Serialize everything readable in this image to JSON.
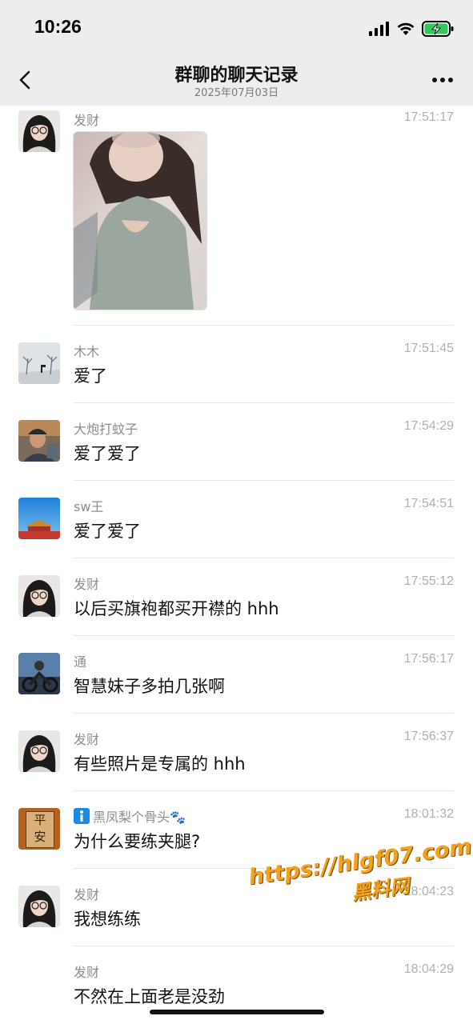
{
  "status_bar": {
    "time": "10:26"
  },
  "header": {
    "title": "群聊的聊天记录",
    "subtitle": "2025年07月03日"
  },
  "messages": [
    {
      "sender": "发财",
      "time": "17:51:17",
      "type": "image"
    },
    {
      "sender": "木木",
      "time": "17:51:45",
      "text": "爱了"
    },
    {
      "sender": "大炮打蚊子",
      "time": "17:54:29",
      "text": "爱了爱了"
    },
    {
      "sender": "sw王",
      "time": "17:54:51",
      "text": "爱了爱了"
    },
    {
      "sender": "发财",
      "time": "17:55:12",
      "text": "以后买旗袍都买开襟的 hhh"
    },
    {
      "sender": "通",
      "time": "17:56:17",
      "text": "智慧妹子多拍几张啊"
    },
    {
      "sender": "发财",
      "time": "17:56:37",
      "text": "有些照片是专属的 hhh"
    },
    {
      "sender": "黑凤梨个骨头🐾",
      "time": "18:01:32",
      "text": "为什么要练夹腿?"
    },
    {
      "sender": "发财",
      "time": "18:04:23",
      "text": "我想练练"
    },
    {
      "sender": "发财",
      "time": "18:04:29",
      "text": "不然在上面老是没劲"
    }
  ],
  "avatars": {
    "pingan_line1": "平",
    "pingan_line2": "安"
  },
  "watermark": {
    "line1": "https://hlgf07.com",
    "line2": "黑料网"
  }
}
